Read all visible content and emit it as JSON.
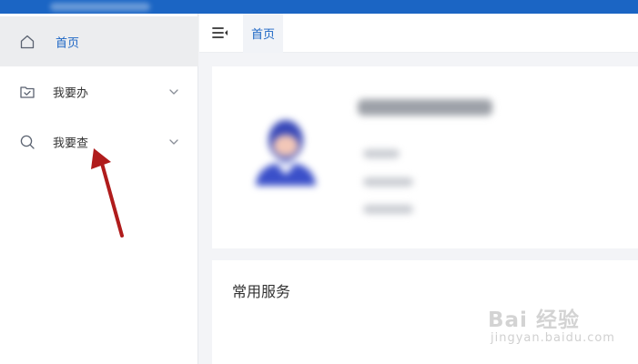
{
  "sidebar": {
    "items": [
      {
        "label": "首页",
        "icon": "home-icon",
        "active": true
      },
      {
        "label": "我要办",
        "icon": "folder-check-icon",
        "expandable": true
      },
      {
        "label": "我要查",
        "icon": "search-icon",
        "expandable": true
      }
    ]
  },
  "tabbar": {
    "tabs": [
      {
        "label": "首页",
        "active": true
      }
    ]
  },
  "services": {
    "title": "常用服务"
  },
  "watermark": {
    "main": "Bai 经验",
    "sub": "jingyan.baidu.com"
  },
  "colors": {
    "accent": "#1b65c4",
    "annotation_arrow": "#b01c1c"
  }
}
